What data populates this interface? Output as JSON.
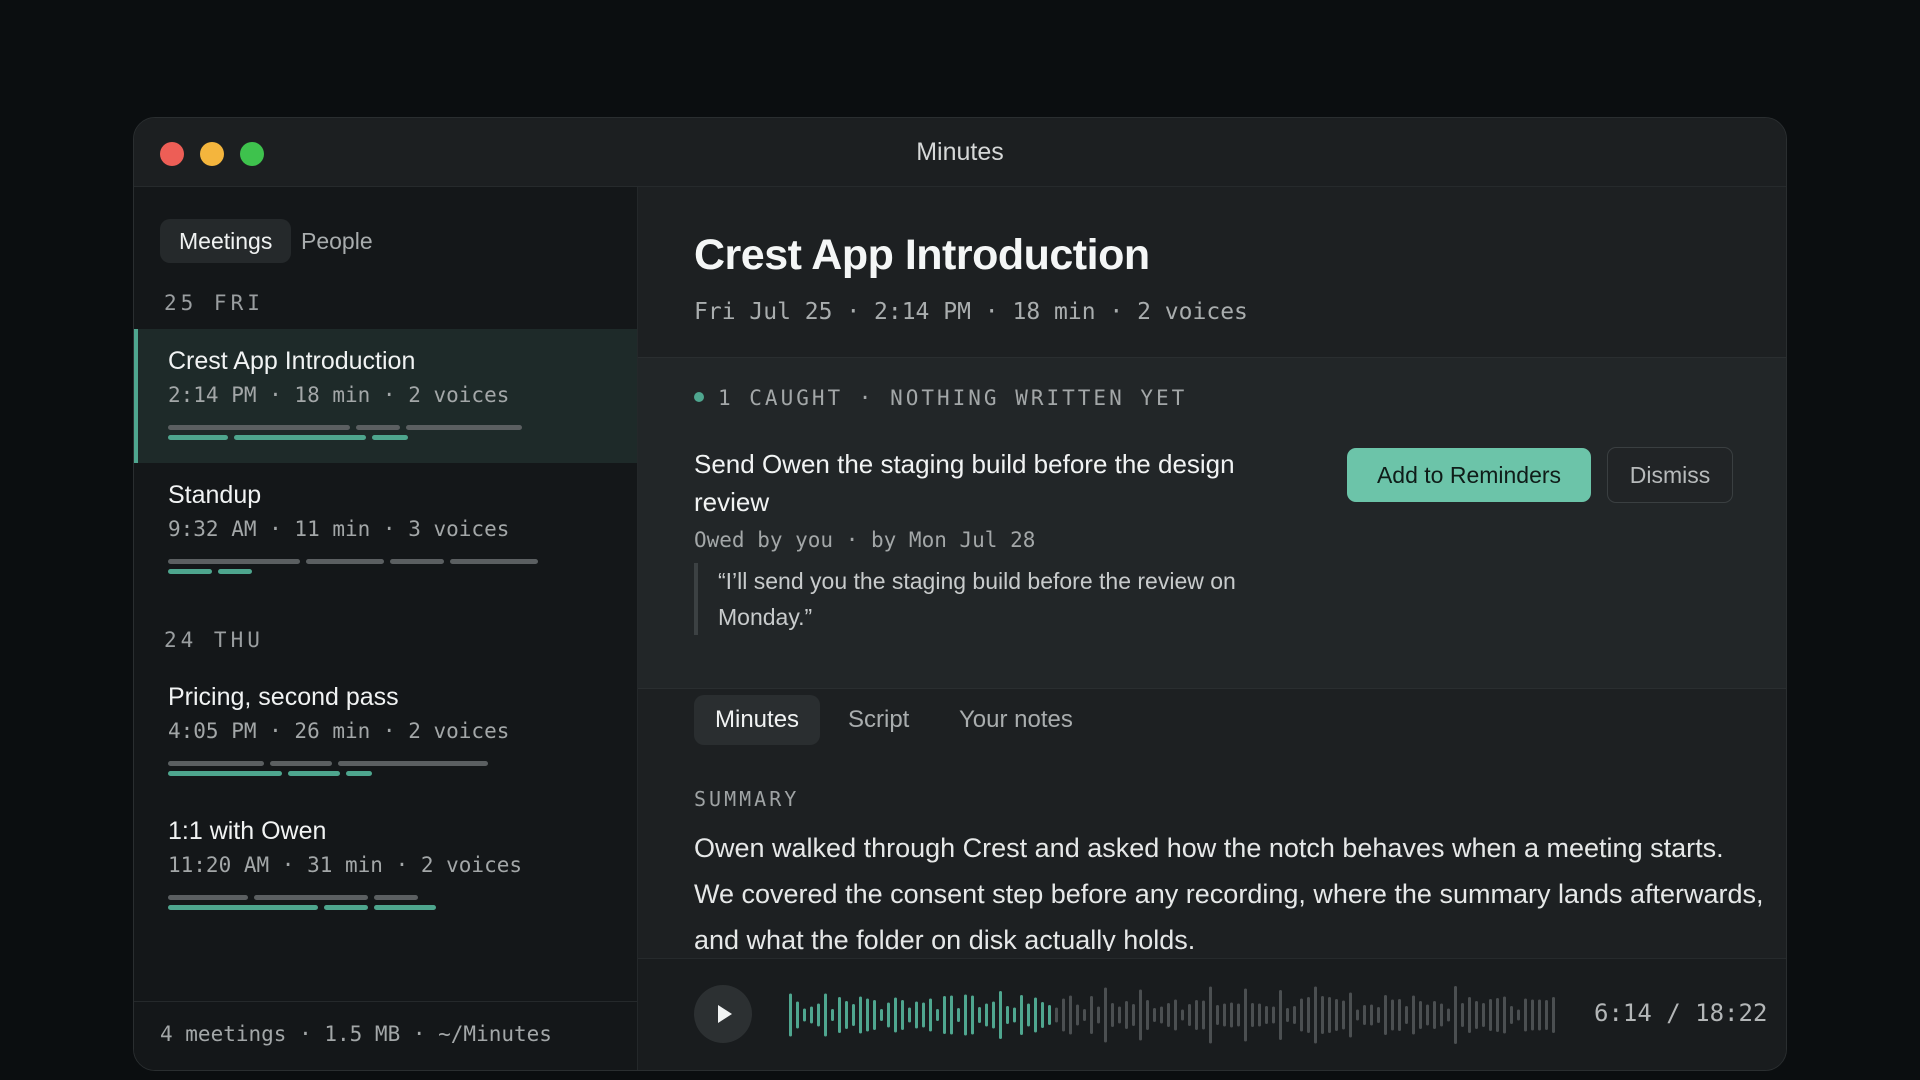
{
  "window": {
    "title": "Minutes"
  },
  "sidebar": {
    "segments": [
      "Meetings",
      "People"
    ],
    "groups": [
      {
        "day": "25 FRI",
        "meetings": [
          {
            "title": "Crest App Introduction",
            "meta": "2:14 PM · 18 min · 2 voices",
            "selected": true
          },
          {
            "title": "Standup",
            "meta": "9:32 AM · 11 min · 3 voices",
            "selected": false
          }
        ]
      },
      {
        "day": "24 THU",
        "meetings": [
          {
            "title": "Pricing, second pass",
            "meta": "4:05 PM · 26 min · 2 voices",
            "selected": false
          },
          {
            "title": "1:1 with Owen",
            "meta": "11:20 AM · 31 min · 2 voices",
            "selected": false
          }
        ]
      }
    ],
    "footer": "4 meetings · 1.5 MB · ~/Minutes"
  },
  "meeting": {
    "title": "Crest App Introduction",
    "meta": "Fri Jul 25 · 2:14 PM · 18 min · 2 voices"
  },
  "caught": {
    "header": "1 CAUGHT · NOTHING WRITTEN YET",
    "task_title": "Send Owen the staging build before the design review",
    "task_meta": "Owed by you · by Mon Jul 28",
    "quote": "“I’ll send you the staging build before the review on Monday.”",
    "primary_button": "Add to Reminders",
    "secondary_button": "Dismiss"
  },
  "tabs": [
    "Minutes",
    "Script",
    "Your notes"
  ],
  "summary": {
    "label": "SUMMARY",
    "text": "Owen walked through Crest and asked how the notch behaves when a meeting starts. We covered the consent step before any recording, where the summary lands afterwards, and what the folder on disk actually holds."
  },
  "player": {
    "time": "6:14 / 18:22",
    "progress": 0.34
  },
  "colors": {
    "accent": "#4fa68f",
    "button": "#6cc4a9",
    "background": "#0b0e10"
  },
  "icons": {
    "play": "play-icon"
  }
}
